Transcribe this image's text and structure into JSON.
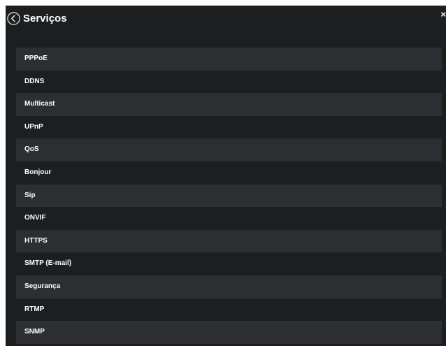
{
  "header": {
    "title": "Serviços",
    "back_icon": "chevron-left-circle-icon",
    "close_icon": "close-icon",
    "close_glyph": "×"
  },
  "menu": {
    "items": [
      {
        "label": "PPPoE"
      },
      {
        "label": "DDNS"
      },
      {
        "label": "Multicast"
      },
      {
        "label": "UPnP"
      },
      {
        "label": "QoS"
      },
      {
        "label": "Bonjour"
      },
      {
        "label": "Sip"
      },
      {
        "label": "ONVIF"
      },
      {
        "label": "HTTPS"
      },
      {
        "label": "SMTP (E-mail)"
      },
      {
        "label": "Segurança"
      },
      {
        "label": "RTMP"
      },
      {
        "label": "SNMP"
      }
    ]
  },
  "colors": {
    "panel_background": "#1d1e20",
    "row_stripe": "#2c2e31",
    "text": "#ffffff"
  }
}
